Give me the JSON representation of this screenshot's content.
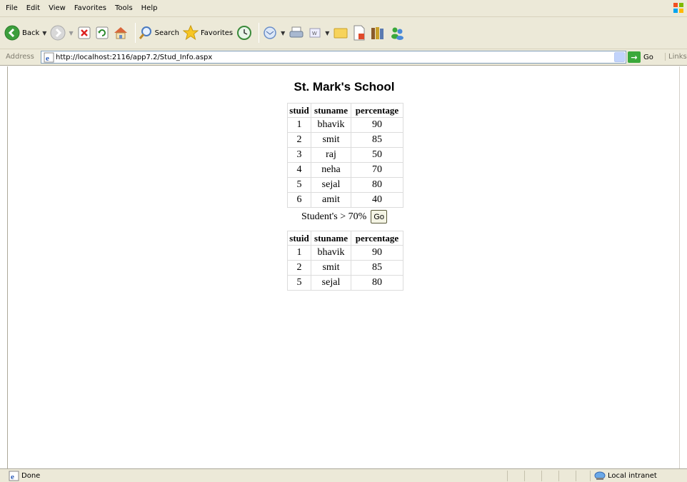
{
  "menu": [
    "File",
    "Edit",
    "View",
    "Favorites",
    "Tools",
    "Help"
  ],
  "toolbar": {
    "back_label": "Back",
    "search_label": "Search",
    "favorites_label": "Favorites"
  },
  "address": {
    "label": "Address",
    "url": "http://localhost:2116/app7.2/Stud_Info.aspx",
    "go_label": "Go",
    "links_label": "Links"
  },
  "page": {
    "title": "St. Mark's School",
    "columns": [
      "stuid",
      "stuname",
      "percentage"
    ],
    "all_students": [
      [
        "1",
        "bhavik",
        "90"
      ],
      [
        "2",
        "smit",
        "85"
      ],
      [
        "3",
        "raj",
        "50"
      ],
      [
        "4",
        "neha",
        "70"
      ],
      [
        "5",
        "sejal",
        "80"
      ],
      [
        "6",
        "amit",
        "40"
      ]
    ],
    "filter_label": "Student's > 70%",
    "filter_button": "Go",
    "filtered_students": [
      [
        "1",
        "bhavik",
        "90"
      ],
      [
        "2",
        "smit",
        "85"
      ],
      [
        "5",
        "sejal",
        "80"
      ]
    ]
  },
  "status": {
    "text": "Done",
    "zone": "Local intranet"
  }
}
